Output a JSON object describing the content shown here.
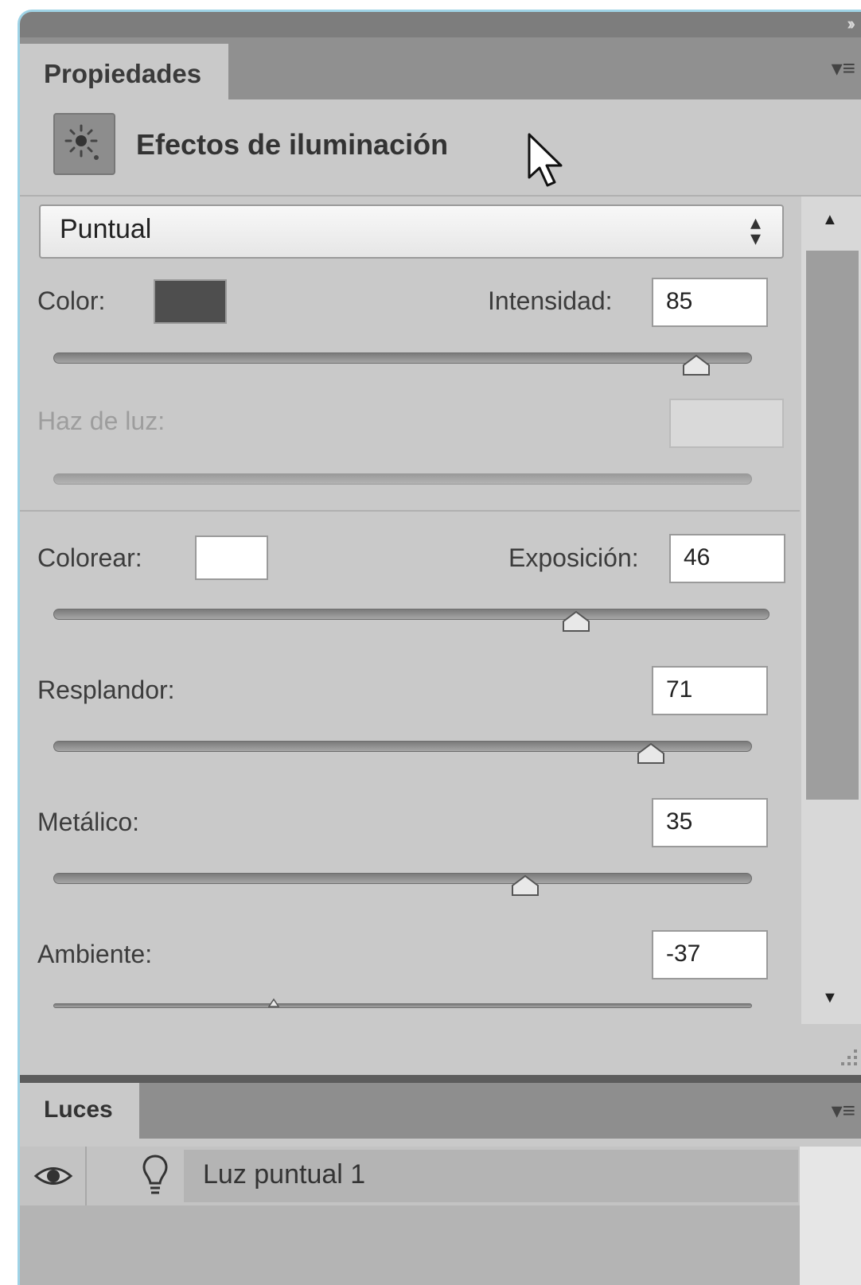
{
  "panel": {
    "tab_label": "Propiedades",
    "effect_title": "Efectos de iluminación",
    "effect_icon": "light-burst-icon"
  },
  "light_type": {
    "selected": "Puntual"
  },
  "controls": {
    "color_label": "Color:",
    "color_swatch": "#4e4e4e",
    "intensidad_label": "Intensidad:",
    "intensidad_value": "85",
    "intensidad_level": 0.92,
    "haz_label": "Haz de luz:",
    "haz_value": "",
    "colorear_label": "Colorear:",
    "colorear_swatch": "#ffffff",
    "exposicion_label": "Exposición:",
    "exposicion_value": "46",
    "exposicion_level": 0.73,
    "resplandor_label": "Resplandor:",
    "resplandor_value": "71",
    "resplandor_level": 0.855,
    "metalico_label": "Metálico:",
    "metalico_value": "35",
    "metalico_level": 0.675,
    "ambiente_label": "Ambiente:",
    "ambiente_value": "-37",
    "ambiente_level": 0.315
  },
  "lights_panel": {
    "tab_label": "Luces",
    "items": [
      {
        "name": "Luz puntual 1",
        "visible": true
      }
    ]
  }
}
